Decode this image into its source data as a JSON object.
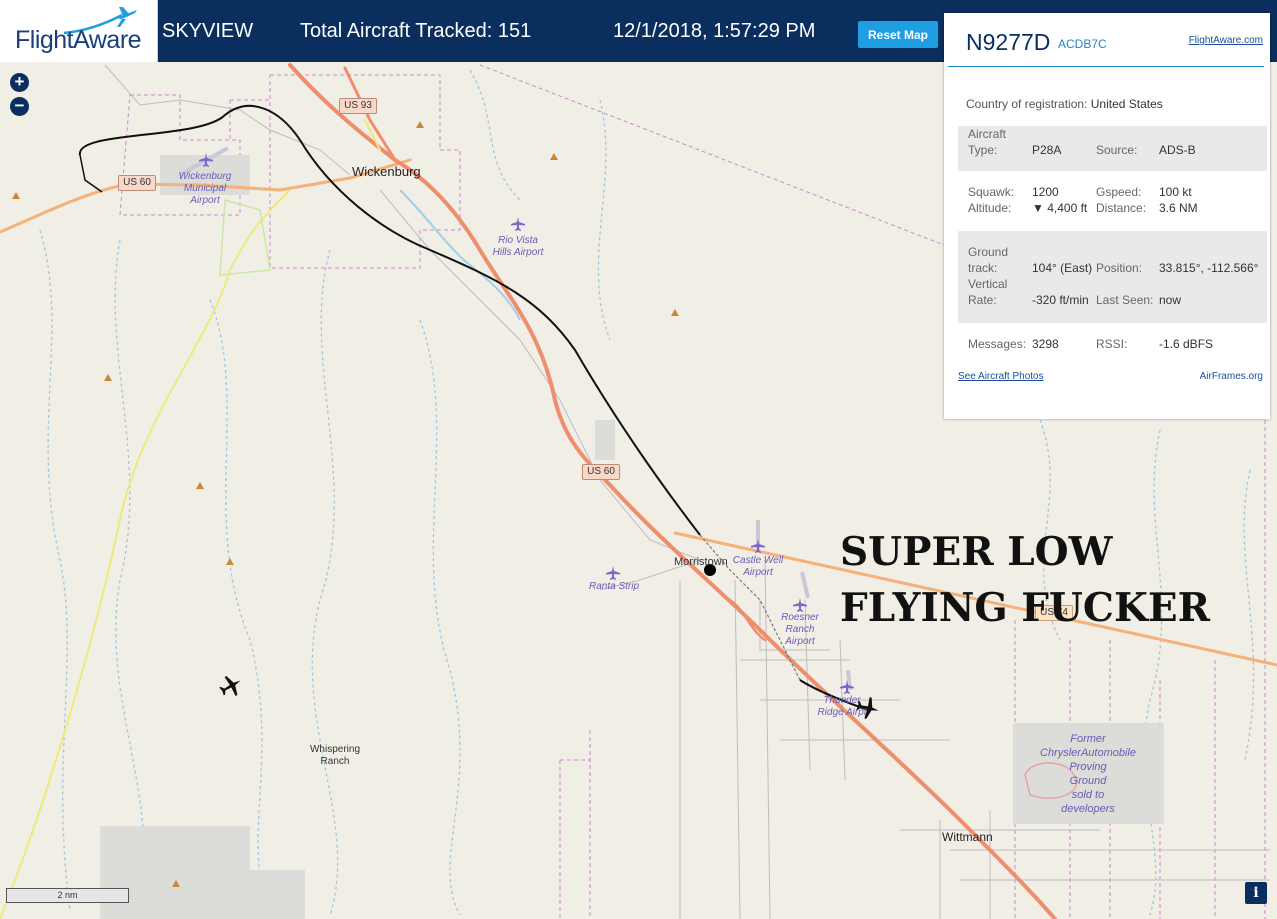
{
  "header": {
    "logo": "FlightAware",
    "app_name": "SKYVIEW",
    "total_label": "Total Aircraft Tracked: 151",
    "datetime": "12/1/2018, 1:57:29 PM",
    "reset_label": "Reset Map"
  },
  "map": {
    "zoom_in": "+",
    "zoom_out": "−",
    "scale_label": "2 nm",
    "info_label": "i",
    "towns": {
      "wickenburg": "Wickenburg",
      "morristown": "Morristown",
      "wittmann": "Wittmann",
      "whispering": "Whispering",
      "ranch": "Ranch"
    },
    "airports": {
      "wickenburg_1": "Wickenburg",
      "wickenburg_2": "Municipal",
      "wickenburg_3": "Airport",
      "rio_1": "Rio Vista",
      "rio_2": "Hills Airport",
      "castle_1": "Castle Well",
      "castle_2": "Airport",
      "ranta": "Ranta Strip",
      "roesner_1": "Roesner",
      "roesner_2": "Ranch",
      "roesner_3": "Airport",
      "thunder_1": "Thunder",
      "thunder_2": "Ridge Airpt"
    },
    "proving_ground": [
      "Former",
      "ChryslerAutomobile",
      "Proving",
      "Ground",
      "sold to",
      "developers"
    ],
    "highways": {
      "us93": "US 93",
      "us60_west": "US 60",
      "us60_mid": "US 60",
      "us60_east": "US 74"
    }
  },
  "aircraft_panel": {
    "registration": "N9277D",
    "hex": "ACDB7C",
    "link": "FlightAware.com",
    "country_label": "Country of registration:",
    "country_value": "United States",
    "aircraft_type_label_1": "Aircraft",
    "aircraft_type_label_2": "Type:",
    "aircraft_type": "P28A",
    "source_label": "Source:",
    "source": "ADS-B",
    "squawk_label": "Squawk:",
    "squawk": "1200",
    "gspeed_label": "Gspeed:",
    "gspeed": "100 kt",
    "altitude_label": "Altitude:",
    "altitude": "▼ 4,400 ft",
    "distance_label": "Distance:",
    "distance": "3.6 NM",
    "track_label_1": "Ground",
    "track_label_2": "track:",
    "track": "104° (East)",
    "position_label": "Position:",
    "position": "33.815°, -112.566°",
    "vrate_label_1": "Vertical",
    "vrate_label_2": "Rate:",
    "vrate": "-320 ft/min",
    "lastseen_label": "Last Seen:",
    "lastseen": "now",
    "messages_label": "Messages:",
    "messages": "3298",
    "rssi_label": "RSSI:",
    "rssi": "-1.6 dBFS",
    "photos_link": "See Aircraft Photos",
    "airframes_link": "AirFrames.org"
  },
  "annotation": {
    "line1": "SUPER LOW",
    "line2": "FLYING FUCKER"
  },
  "colors": {
    "header_bg": "#0a2e5e",
    "accent": "#1f9ee2",
    "map_bg": "#f1eee6",
    "highway": "#ef9a72",
    "track": "#111111"
  }
}
